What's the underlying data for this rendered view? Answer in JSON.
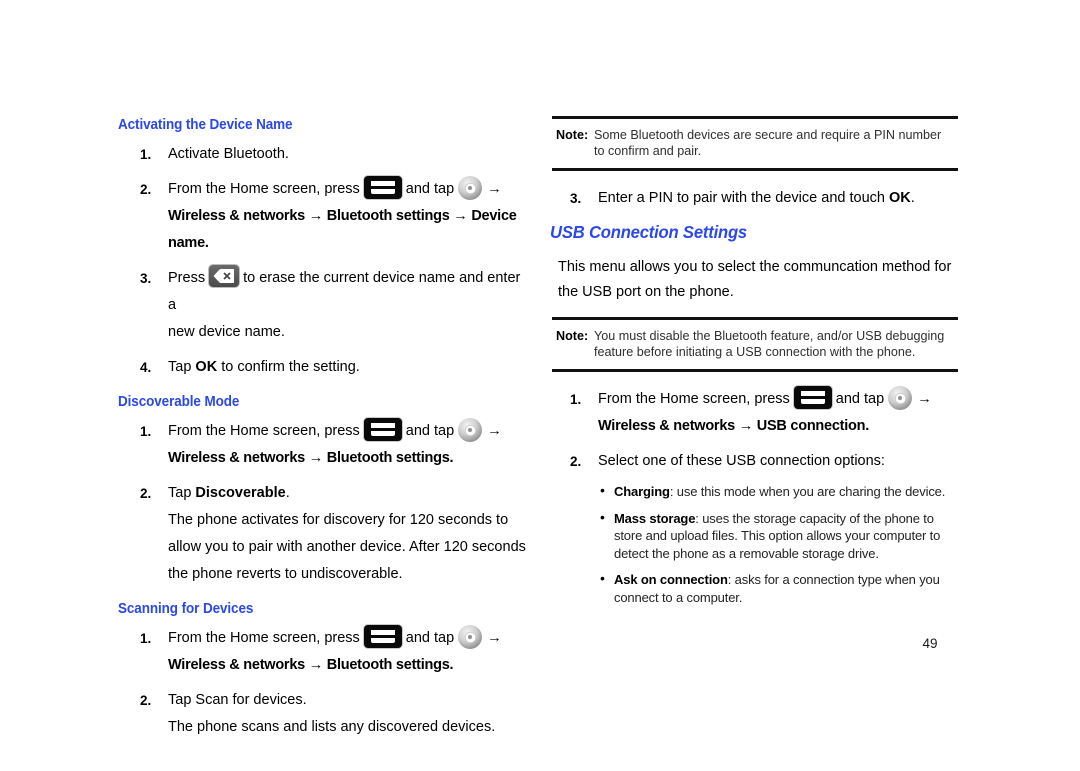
{
  "page": {
    "number": "49"
  },
  "left_column": {
    "section1": {
      "heading": "Activating the Device Name",
      "steps": [
        {
          "num": "1.",
          "text": "Activate Bluetooth."
        },
        {
          "num": "2.",
          "prefix": "From the Home screen, press",
          "middle": "and tap",
          "path_line": "Wireless & networks → Bluetooth settings → Device name.",
          "menu_icon": "menu-icon",
          "settings_icon": "settings-icon",
          "arrow": "→"
        },
        {
          "num": "3.",
          "prefix": "Press",
          "suffix": "to erase the current device name and enter a",
          "line2": "new device name.",
          "backspace_icon": "backspace-key-icon"
        },
        {
          "num": "4.",
          "pre_bold": "Tap ",
          "bold": "OK",
          "post_bold": " to confirm the setting."
        }
      ]
    },
    "section2": {
      "heading": "Discoverable Mode",
      "steps": [
        {
          "num": "1.",
          "prefix": "From the Home screen, press",
          "middle": "and tap",
          "path_line": "Wireless & networks → Bluetooth settings.",
          "arrow": "→"
        },
        {
          "num": "2.",
          "pre_bold": "Tap ",
          "bold": "Discoverable",
          "post_bold": ".",
          "para": "The phone activates for discovery for 120 seconds to allow you to pair with another device. After 120 seconds the phone reverts to undiscoverable."
        }
      ]
    },
    "section3": {
      "heading": "Scanning for Devices",
      "steps": [
        {
          "num": "1.",
          "prefix": "From the Home screen, press",
          "middle": "and tap",
          "path_line": "Wireless & networks → Bluetooth settings.",
          "arrow": "→"
        },
        {
          "num": "2.",
          "text": "Tap Scan for devices.",
          "para": "The phone scans and lists any discovered devices."
        }
      ]
    }
  },
  "right_column": {
    "note1": {
      "label": "Note:",
      "text": "Some Bluetooth devices are secure and require a PIN number to confirm and pair."
    },
    "step3": {
      "num": "3.",
      "pre_bold": "Enter a PIN to pair with the device and touch ",
      "bold": "OK",
      "post_bold": "."
    },
    "section_usb": {
      "heading": "USB Connection Settings",
      "intro": "This menu allows you to select the communcation method for the USB port on the phone."
    },
    "note2": {
      "label": "Note:",
      "text": "You must disable the Bluetooth feature, and/or USB debugging feature before initiating a USB connection with the phone."
    },
    "steps": [
      {
        "num": "1.",
        "prefix": "From the Home screen, press",
        "middle": "and tap",
        "path_line": "Wireless & networks → USB connection.",
        "arrow": "→"
      },
      {
        "num": "2.",
        "text": "Select one of these USB connection options:"
      }
    ],
    "bullets": [
      {
        "bold": "Charging",
        "text": ": use this mode when you are charing the device."
      },
      {
        "bold": "Mass storage",
        "text": ": uses the storage capacity of the phone to store and upload files. This option allows your computer to detect the phone as a removable storage drive."
      },
      {
        "bold": "Ask on connection",
        "text": ": asks for a connection type when you connect to a computer."
      }
    ]
  },
  "colors": {
    "heading_blue": "#2B48E8",
    "text_black": "#000000",
    "note_rule": "#111111"
  }
}
